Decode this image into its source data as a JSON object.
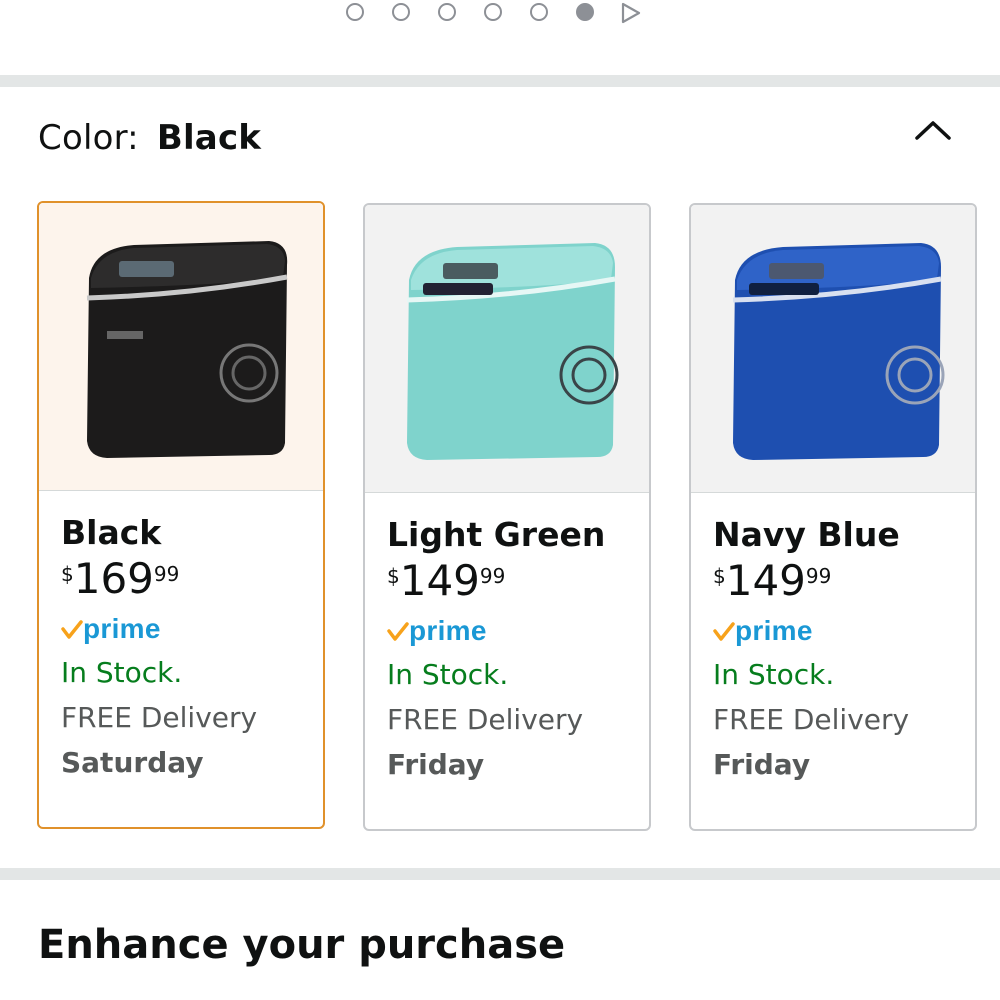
{
  "carousel": {
    "dot_count": 6,
    "active_index": 5,
    "play_icon": "play-icon"
  },
  "color_selector": {
    "label": "Color:",
    "selected": "Black",
    "collapse_icon": "chevron-up-icon",
    "options": [
      {
        "name": "Black",
        "price_symbol": "$",
        "price_whole": "169",
        "price_fraction": "99",
        "prime": "prime",
        "stock": "In Stock.",
        "delivery": "FREE Delivery",
        "delivery_day": "Saturday",
        "color": "#1c1b1b",
        "selected": true
      },
      {
        "name": "Light Green",
        "price_symbol": "$",
        "price_whole": "149",
        "price_fraction": "99",
        "prime": "prime",
        "stock": "In Stock.",
        "delivery": "FREE Delivery",
        "delivery_day": "Friday",
        "color": "#7fd3cc",
        "selected": false
      },
      {
        "name": "Navy Blue",
        "price_symbol": "$",
        "price_whole": "149",
        "price_fraction": "99",
        "prime": "prime",
        "stock": "In Stock.",
        "delivery": "FREE Delivery",
        "delivery_day": "Friday",
        "color": "#1e4fb0",
        "selected": false
      }
    ]
  },
  "section": {
    "title": "Enhance your purchase"
  },
  "colors": {
    "selected_border": "#e0912b",
    "in_stock": "#067d1d",
    "prime_blue": "#1a98d5",
    "prime_check": "#f7a21b",
    "divider": "#e3e6e6"
  }
}
